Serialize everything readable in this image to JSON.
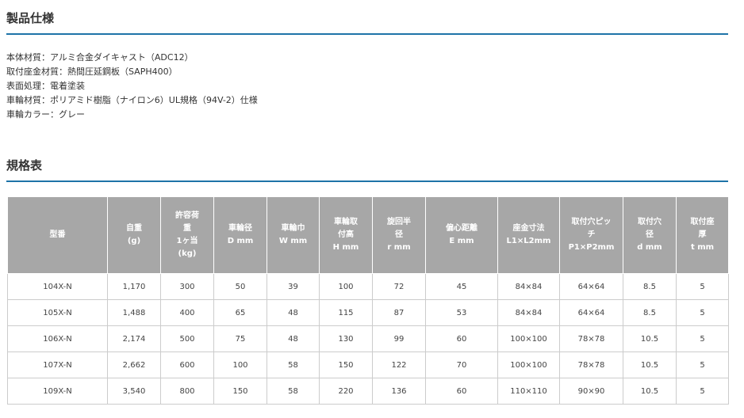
{
  "spec_section": {
    "title": "製品仕様",
    "lines": [
      "本体材質：アルミ合金ダイキャスト（ADC12）",
      "取付座金材質：熱間圧延鋼板（SAPH400）",
      "表面処理：電着塗装",
      "車輪材質：ポリアミド樹脂（ナイロン6）UL規格（94V-2）仕様",
      "車輪カラー：グレー"
    ]
  },
  "table_section": {
    "title": "規格表",
    "headers": [
      [
        "型番"
      ],
      [
        "自重",
        "(g)"
      ],
      [
        "許容荷",
        "重",
        "1ヶ当",
        "(kg)"
      ],
      [
        "車輪径",
        "D mm"
      ],
      [
        "車輪巾",
        "W mm"
      ],
      [
        "車輪取",
        "付高",
        "H mm"
      ],
      [
        "旋回半",
        "径",
        "r mm"
      ],
      [
        "偏心距離",
        "E mm"
      ],
      [
        "座金寸法",
        "L1×L2mm"
      ],
      [
        "取付穴ピッ",
        "チ",
        "P1×P2mm"
      ],
      [
        "取付穴",
        "径",
        "d mm"
      ],
      [
        "取付座",
        "厚",
        "t mm"
      ]
    ],
    "rows": [
      [
        "104X-N",
        "1,170",
        "300",
        "50",
        "39",
        "100",
        "72",
        "45",
        "84×84",
        "64×64",
        "8.5",
        "5"
      ],
      [
        "105X-N",
        "1,488",
        "400",
        "65",
        "48",
        "115",
        "87",
        "53",
        "84×84",
        "64×64",
        "8.5",
        "5"
      ],
      [
        "106X-N",
        "2,174",
        "500",
        "75",
        "48",
        "130",
        "99",
        "60",
        "100×100",
        "78×78",
        "10.5",
        "5"
      ],
      [
        "107X-N",
        "2,662",
        "600",
        "100",
        "58",
        "150",
        "122",
        "70",
        "100×100",
        "78×78",
        "10.5",
        "5"
      ],
      [
        "109X-N",
        "3,540",
        "800",
        "150",
        "58",
        "220",
        "136",
        "60",
        "110×110",
        "90×90",
        "10.5",
        "5"
      ]
    ]
  },
  "colors": {
    "rule": "#1e73a8",
    "header_bg": "#a7a7a7",
    "header_text": "#ffffff",
    "cell_border": "#cccccc"
  }
}
